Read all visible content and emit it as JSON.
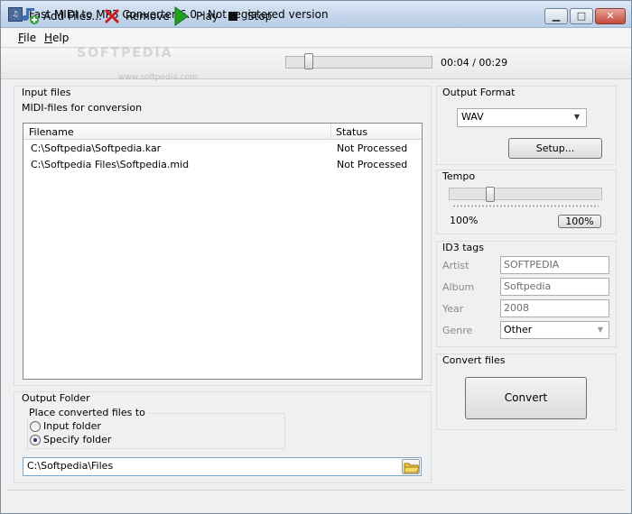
{
  "window": {
    "title": "Fast MIDI to MP3 Converter 6.0 - Not registered version",
    "minimize": "▁",
    "maximize": "□",
    "close": "✕"
  },
  "menu": {
    "items": [
      {
        "label": "File"
      },
      {
        "label": "Help"
      }
    ]
  },
  "toolbar": {
    "add_label": "Add Files...",
    "remove_label": "Remove",
    "play_label": "Play",
    "stop_label": "Stop",
    "seek_position": 0.13,
    "time": "00:04 / 00:29"
  },
  "watermark": {
    "text": "SOFTPEDIA",
    "url": "www.softpedia.com"
  },
  "input_files": {
    "group_title": "Input files",
    "subtitle": "MIDI-files for conversion",
    "columns": [
      "Filename",
      "Status"
    ],
    "rows": [
      {
        "filename": "C:\\Softpedia\\Softpedia.kar",
        "status": "Not Processed"
      },
      {
        "filename": "C:\\Softpedia Files\\Softpedia.mid",
        "status": "Not Processed"
      }
    ]
  },
  "output_folder": {
    "group_title": "Output Folder",
    "place_title": "Place converted files to",
    "options": [
      {
        "label": "Input folder",
        "checked": false
      },
      {
        "label": "Specify folder",
        "checked": true
      }
    ],
    "path": "C:\\Softpedia\\Files"
  },
  "output_format": {
    "group_title": "Output Format",
    "selected": "WAV",
    "setup_label": "Setup..."
  },
  "tempo": {
    "group_title": "Tempo",
    "value_text": "100%",
    "reset_label": "100%",
    "slider_position": 0.25
  },
  "id3": {
    "group_title": "ID3 tags",
    "fields": [
      {
        "label": "Artist",
        "value": "SOFTPEDIA"
      },
      {
        "label": "Album",
        "value": "Softpedia"
      },
      {
        "label": "Year",
        "value": "2008"
      },
      {
        "label": "Genre",
        "value": "Other"
      }
    ]
  },
  "convert": {
    "group_title": "Convert files",
    "button_label": "Convert"
  },
  "colors": {
    "title_bar": "#c6d7ec",
    "close_button": "#c4483a",
    "window_bg": "#f0f0f0"
  }
}
